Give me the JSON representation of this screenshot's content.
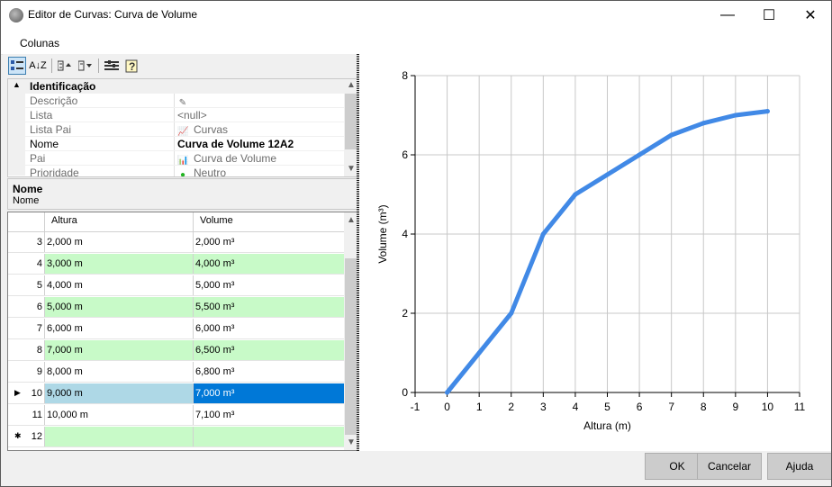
{
  "window": {
    "title": "Editor de Curvas: Curva de Volume",
    "app_icon": "app-icon",
    "controls": {
      "minimize": "—",
      "maximize": "☐",
      "close": "✕"
    }
  },
  "menu": {
    "items": [
      "Colunas"
    ]
  },
  "toolbar": {
    "icons": [
      "categorized-icon",
      "alphabetical-sort-icon",
      "expand-icon",
      "collapse-icon",
      "property-pages-icon",
      "help-icon"
    ],
    "alpha_glyph": "A↓Z"
  },
  "property_grid": {
    "category": "Identificação",
    "collapse_glyph": "▲",
    "rows": [
      {
        "label": "Descrição",
        "value": "",
        "icon": "edit-icon",
        "icon_glyph": "✎",
        "bold": false
      },
      {
        "label": "Lista",
        "value": "<null>",
        "icon": "",
        "icon_glyph": "",
        "bold": false
      },
      {
        "label": "Lista Pai",
        "value": "Curvas",
        "icon": "curve-icon",
        "icon_glyph": "📈",
        "bold": false
      },
      {
        "label": "Nome",
        "value": "Curva de Volume 12A2",
        "icon": "",
        "icon_glyph": "",
        "bold": true
      },
      {
        "label": "Pai",
        "value": "Curva de Volume",
        "icon": "chart-icon",
        "icon_glyph": "📊",
        "bold": false
      },
      {
        "label": "Prioridade",
        "value": "Neutro",
        "icon": "green-dot-icon",
        "icon_glyph": "●",
        "bold": false
      }
    ]
  },
  "help": {
    "title": "Nome",
    "description": "Nome"
  },
  "grid": {
    "columns": [
      "Altura",
      "Volume"
    ],
    "rows": [
      {
        "index": "3",
        "altura": "2,000 m",
        "volume": "2,000 m³"
      },
      {
        "index": "4",
        "altura": "3,000 m",
        "volume": "4,000 m³"
      },
      {
        "index": "5",
        "altura": "4,000 m",
        "volume": "5,000 m³"
      },
      {
        "index": "6",
        "altura": "5,000 m",
        "volume": "5,500 m³"
      },
      {
        "index": "7",
        "altura": "6,000 m",
        "volume": "6,000 m³"
      },
      {
        "index": "8",
        "altura": "7,000 m",
        "volume": "6,500 m³"
      },
      {
        "index": "9",
        "altura": "8,000 m",
        "volume": "6,800 m³"
      },
      {
        "index": "10",
        "altura": "9,000 m",
        "volume": "7,000 m³"
      },
      {
        "index": "11",
        "altura": "10,000 m",
        "volume": "7,100 m³"
      },
      {
        "index": "12",
        "altura": "",
        "volume": ""
      }
    ],
    "selected_row": "10",
    "current_marker": "▶",
    "new_row_marker": "✱"
  },
  "chart_data": {
    "type": "line",
    "xlabel": "Altura (m)",
    "ylabel": "Volume (m³)",
    "xlim": [
      -1,
      11
    ],
    "ylim": [
      0,
      8
    ],
    "xticks": [
      "-1",
      "0",
      "1",
      "2",
      "3",
      "4",
      "5",
      "6",
      "7",
      "8",
      "9",
      "10",
      "11"
    ],
    "yticks": [
      "0",
      "2",
      "4",
      "6",
      "8"
    ],
    "grid": true,
    "series": [
      {
        "x": [
          0,
          1,
          2,
          3,
          4,
          5,
          6,
          7,
          8,
          9,
          10
        ],
        "y": [
          0,
          1,
          2,
          4,
          5,
          5.5,
          6,
          6.5,
          6.8,
          7,
          7.1
        ],
        "color": "#4189e6"
      }
    ]
  },
  "buttons": {
    "ok": "OK",
    "cancel": "Cancelar",
    "help": "Ajuda"
  },
  "colors": {
    "alt_row": "#c8fac8",
    "selected_cell": "#0078d7",
    "selected_row": "#aed8e6",
    "line": "#4189e6"
  }
}
